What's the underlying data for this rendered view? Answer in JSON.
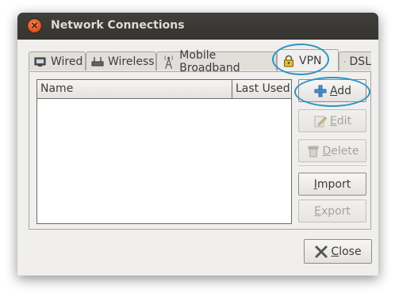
{
  "window": {
    "title": "Network Connections",
    "close_glyph": "×"
  },
  "tabs": [
    {
      "label": "Wired",
      "icon": "wired-icon"
    },
    {
      "label": "Wireless",
      "icon": "wireless-icon"
    },
    {
      "label": "Mobile Broadband",
      "icon": "mobile-broadband-icon"
    },
    {
      "label": "VPN",
      "icon": "vpn-lock-icon",
      "active": true
    },
    {
      "label": "DSL",
      "icon": "dsl-icon"
    }
  ],
  "list": {
    "columns": [
      "Name",
      "Last Used"
    ],
    "rows": []
  },
  "buttons": {
    "add": {
      "mnemonic": "A",
      "rest": "dd",
      "enabled": true
    },
    "edit": {
      "mnemonic": "E",
      "rest": "dit",
      "enabled": false
    },
    "delete": {
      "mnemonic": "D",
      "rest": "elete",
      "enabled": false
    },
    "import": {
      "mnemonic": "I",
      "rest": "mport",
      "enabled": true
    },
    "export": {
      "mnemonic": "E",
      "rest": "xport",
      "enabled": false
    },
    "close": {
      "mnemonic": "C",
      "rest": "lose",
      "enabled": true
    }
  },
  "colors": {
    "highlight_ring": "#2b93c6",
    "titlebar": "#3c3b37"
  }
}
